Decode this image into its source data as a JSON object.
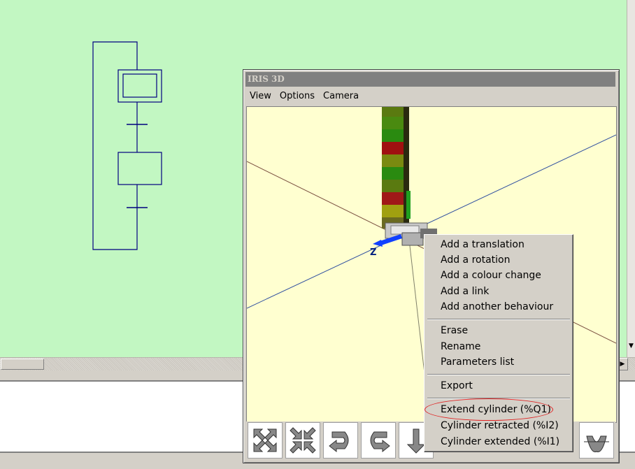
{
  "iris_window": {
    "title": "IRIS 3D",
    "menu": [
      "View",
      "Options",
      "Camera"
    ]
  },
  "viewport": {
    "axis_label": "Z",
    "background_color": "#ffffd0"
  },
  "toolbar": {
    "buttons": [
      {
        "icon": "expand-arrows-icon"
      },
      {
        "icon": "collapse-arrows-icon"
      },
      {
        "icon": "rotate-right-icon"
      },
      {
        "icon": "rotate-left-icon"
      },
      {
        "icon": "arrow-down-icon"
      },
      {
        "icon": "rotate-flip-icon"
      }
    ]
  },
  "context_menu": {
    "group1": [
      "Add a translation",
      "Add a rotation",
      "Add a colour change",
      "Add a link",
      "Add another behaviour"
    ],
    "group2": [
      "Erase",
      "Rename",
      "Parameters list"
    ],
    "group3": [
      "Export"
    ],
    "group4": [
      "Extend cylinder (%Q1)",
      "Cylinder retracted (%I2)",
      "Cylinder extended (%I1)"
    ]
  },
  "colors": {
    "canvas_bg": "#c2f7c2",
    "grafcet_stroke": "#000080",
    "highlight": "#e02020"
  }
}
